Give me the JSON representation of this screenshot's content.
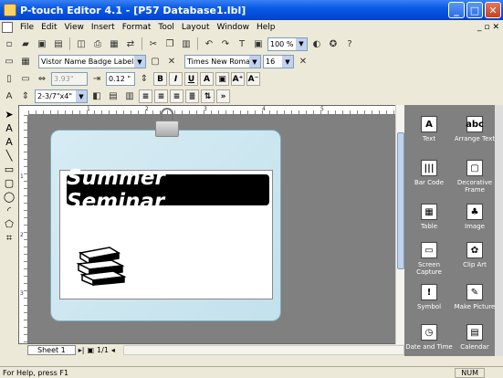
{
  "window": {
    "title": "P-touch Editor 4.1 - [P57 Database1.lbl]",
    "minimize": "_",
    "maximize": "□",
    "close": "✕"
  },
  "menu": [
    "File",
    "Edit",
    "View",
    "Insert",
    "Format",
    "Tool",
    "Layout",
    "Window",
    "Help"
  ],
  "toolbar": {
    "zoom": "100 %"
  },
  "format": {
    "label_type": "Vistor Name Badge Label",
    "width_value": "3.93\"",
    "margin_value": "0.12 \"",
    "length_value": "2-3/7\"x4\"",
    "font_name": "Times New Roman",
    "font_size": "16",
    "bold": "B",
    "italic": "I",
    "underline": "U"
  },
  "canvas": {
    "banner_text": "Summer Seminar",
    "ruler_h": [
      "1",
      "2",
      "3",
      "4",
      "5"
    ],
    "ruler_v": [
      "1",
      "2",
      "3"
    ]
  },
  "sheet": {
    "tab": "Sheet 1",
    "page": "1/1"
  },
  "panel": {
    "items": [
      {
        "label": "Text",
        "icon": "A"
      },
      {
        "label": "Arrange Text",
        "icon": "abc"
      },
      {
        "label": "Bar Code",
        "icon": "|||"
      },
      {
        "label": "Decorative Frame",
        "icon": "▢"
      },
      {
        "label": "Table",
        "icon": "▦"
      },
      {
        "label": "Image",
        "icon": "♣"
      },
      {
        "label": "Screen Capture",
        "icon": "▭"
      },
      {
        "label": "Clip Art",
        "icon": "✿"
      },
      {
        "label": "Symbol",
        "icon": "!"
      },
      {
        "label": "Make Picture",
        "icon": "✎"
      },
      {
        "label": "Date and Time",
        "icon": "◷"
      },
      {
        "label": "Calendar",
        "icon": "▤"
      }
    ]
  },
  "status": {
    "help": "For Help, press F1",
    "num": "NUM"
  }
}
